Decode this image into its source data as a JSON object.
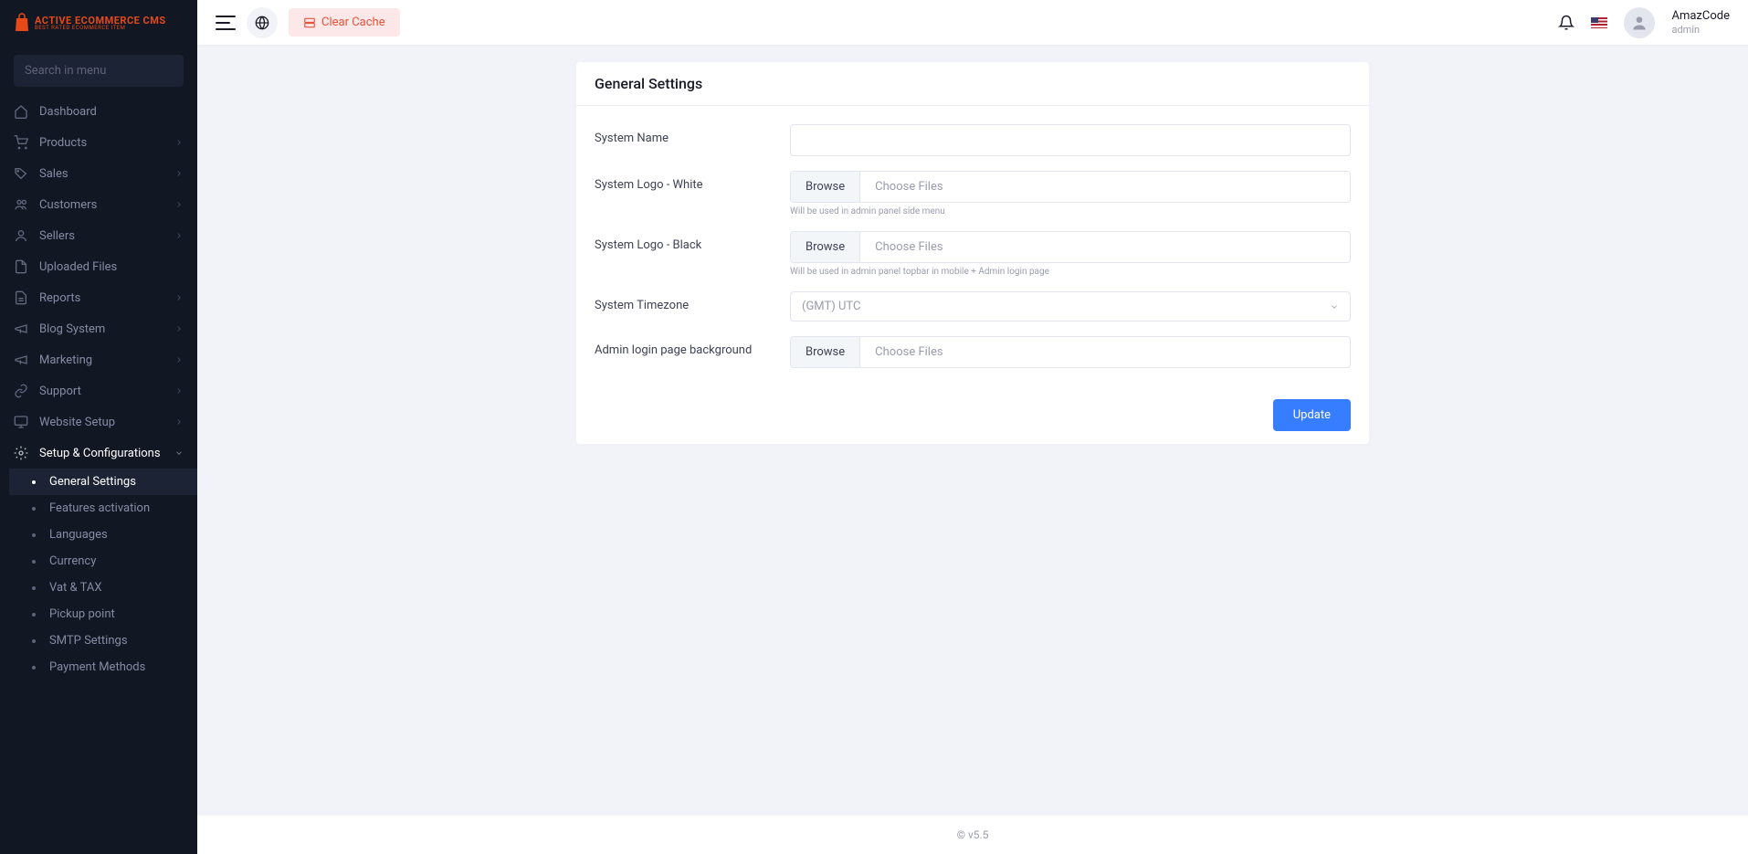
{
  "brand": {
    "line1": "ACTIVE ECOMMERCE CMS",
    "line2": "BEST RATED ECOMMERCE ITEM"
  },
  "search": {
    "placeholder": "Search in menu"
  },
  "nav": [
    {
      "label": "Dashboard",
      "icon": "home",
      "chev": false
    },
    {
      "label": "Products",
      "icon": "cart",
      "chev": true
    },
    {
      "label": "Sales",
      "icon": "tag",
      "chev": true
    },
    {
      "label": "Customers",
      "icon": "users",
      "chev": true
    },
    {
      "label": "Sellers",
      "icon": "user",
      "chev": true
    },
    {
      "label": "Uploaded Files",
      "icon": "file",
      "chev": false
    },
    {
      "label": "Reports",
      "icon": "doc",
      "chev": true
    },
    {
      "label": "Blog System",
      "icon": "mega",
      "chev": true
    },
    {
      "label": "Marketing",
      "icon": "mega",
      "chev": true
    },
    {
      "label": "Support",
      "icon": "link",
      "chev": true
    },
    {
      "label": "Website Setup",
      "icon": "monitor",
      "chev": true
    },
    {
      "label": "Setup & Configurations",
      "icon": "gear",
      "chev": true,
      "open": true,
      "active": true
    }
  ],
  "subnav": [
    {
      "label": "General Settings",
      "active": true
    },
    {
      "label": "Features activation"
    },
    {
      "label": "Languages"
    },
    {
      "label": "Currency"
    },
    {
      "label": "Vat & TAX"
    },
    {
      "label": "Pickup point"
    },
    {
      "label": "SMTP Settings"
    },
    {
      "label": "Payment Methods"
    }
  ],
  "topbar": {
    "clear_cache": "Clear Cache",
    "user_name": "AmazCode",
    "user_role": "admin"
  },
  "settings": {
    "title": "General Settings",
    "fields": {
      "system_name": {
        "label": "System Name",
        "value": ""
      },
      "logo_white": {
        "label": "System Logo - White",
        "browse": "Browse",
        "choose": "Choose Files",
        "hint": "Will be used in admin panel side menu"
      },
      "logo_black": {
        "label": "System Logo - Black",
        "browse": "Browse",
        "choose": "Choose Files",
        "hint": "Will be used in admin panel topbar in mobile + Admin login page"
      },
      "timezone": {
        "label": "System Timezone",
        "value": "(GMT) UTC"
      },
      "login_bg": {
        "label": "Admin login page background",
        "browse": "Browse",
        "choose": "Choose Files"
      }
    },
    "update": "Update"
  },
  "footer": "© v5.5"
}
